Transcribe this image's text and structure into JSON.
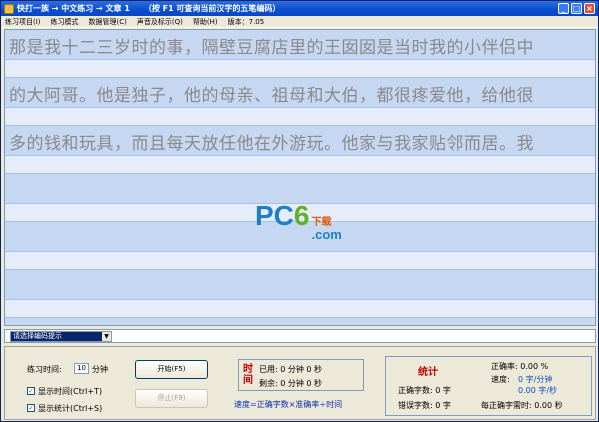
{
  "window": {
    "title": "快打一族 → 中文练习 → 文章 1     （按 F1 可查询当前汉字的五笔编码）",
    "minimize": "_",
    "maximize": "□",
    "close": "×"
  },
  "menu": {
    "items": [
      "练习项目(I)",
      "练习模式",
      "数据管理(C)",
      "声音及标示(Q)",
      "帮助(H)"
    ],
    "version": "版本：7.05"
  },
  "article": {
    "lines": [
      "那是我十二三岁时的事，隔壁豆腐店里的王囡囡是当时我的小伴侣中",
      "的大阿哥。他是独子，他的母亲、祖母和大伯，都很疼爱他，给他很",
      "多的钱和玩具，而且每天放任他在外游玩。他家与我家贴邻而居。我"
    ]
  },
  "watermark": {
    "pc": "PC",
    "six": "6",
    "dl": "下载",
    "com": ".com"
  },
  "encoding": {
    "selected": "请选择编码提示",
    "arrow": "▼"
  },
  "controls": {
    "time_label": "练习时间:",
    "time_value": "10",
    "time_unit": "分钟",
    "show_time": "显示时间(Ctrl+T)",
    "show_stats": "显示统计(Ctrl+S)",
    "show_time_checked": true,
    "show_stats_checked": true,
    "start_button": "开始(F5)",
    "stop_button": "停止(F9)"
  },
  "time_panel": {
    "title": "时间",
    "used": "已用: 0 分钟 0 秒",
    "remaining": "剩余: 0 分钟 0 秒"
  },
  "formula": "速度=正确字数×准确率÷时间",
  "stats": {
    "title": "统计",
    "accuracy": "正确率: 0.00 %",
    "correct": "正确字数: 0 字",
    "errors": "错误字数: 0 字",
    "speed_label": "速度:",
    "speed_chars": "0 字/分钟",
    "speed_sec": "0.00 字/秒",
    "time_per_char": "每正确字需时: 0.00 秒"
  }
}
